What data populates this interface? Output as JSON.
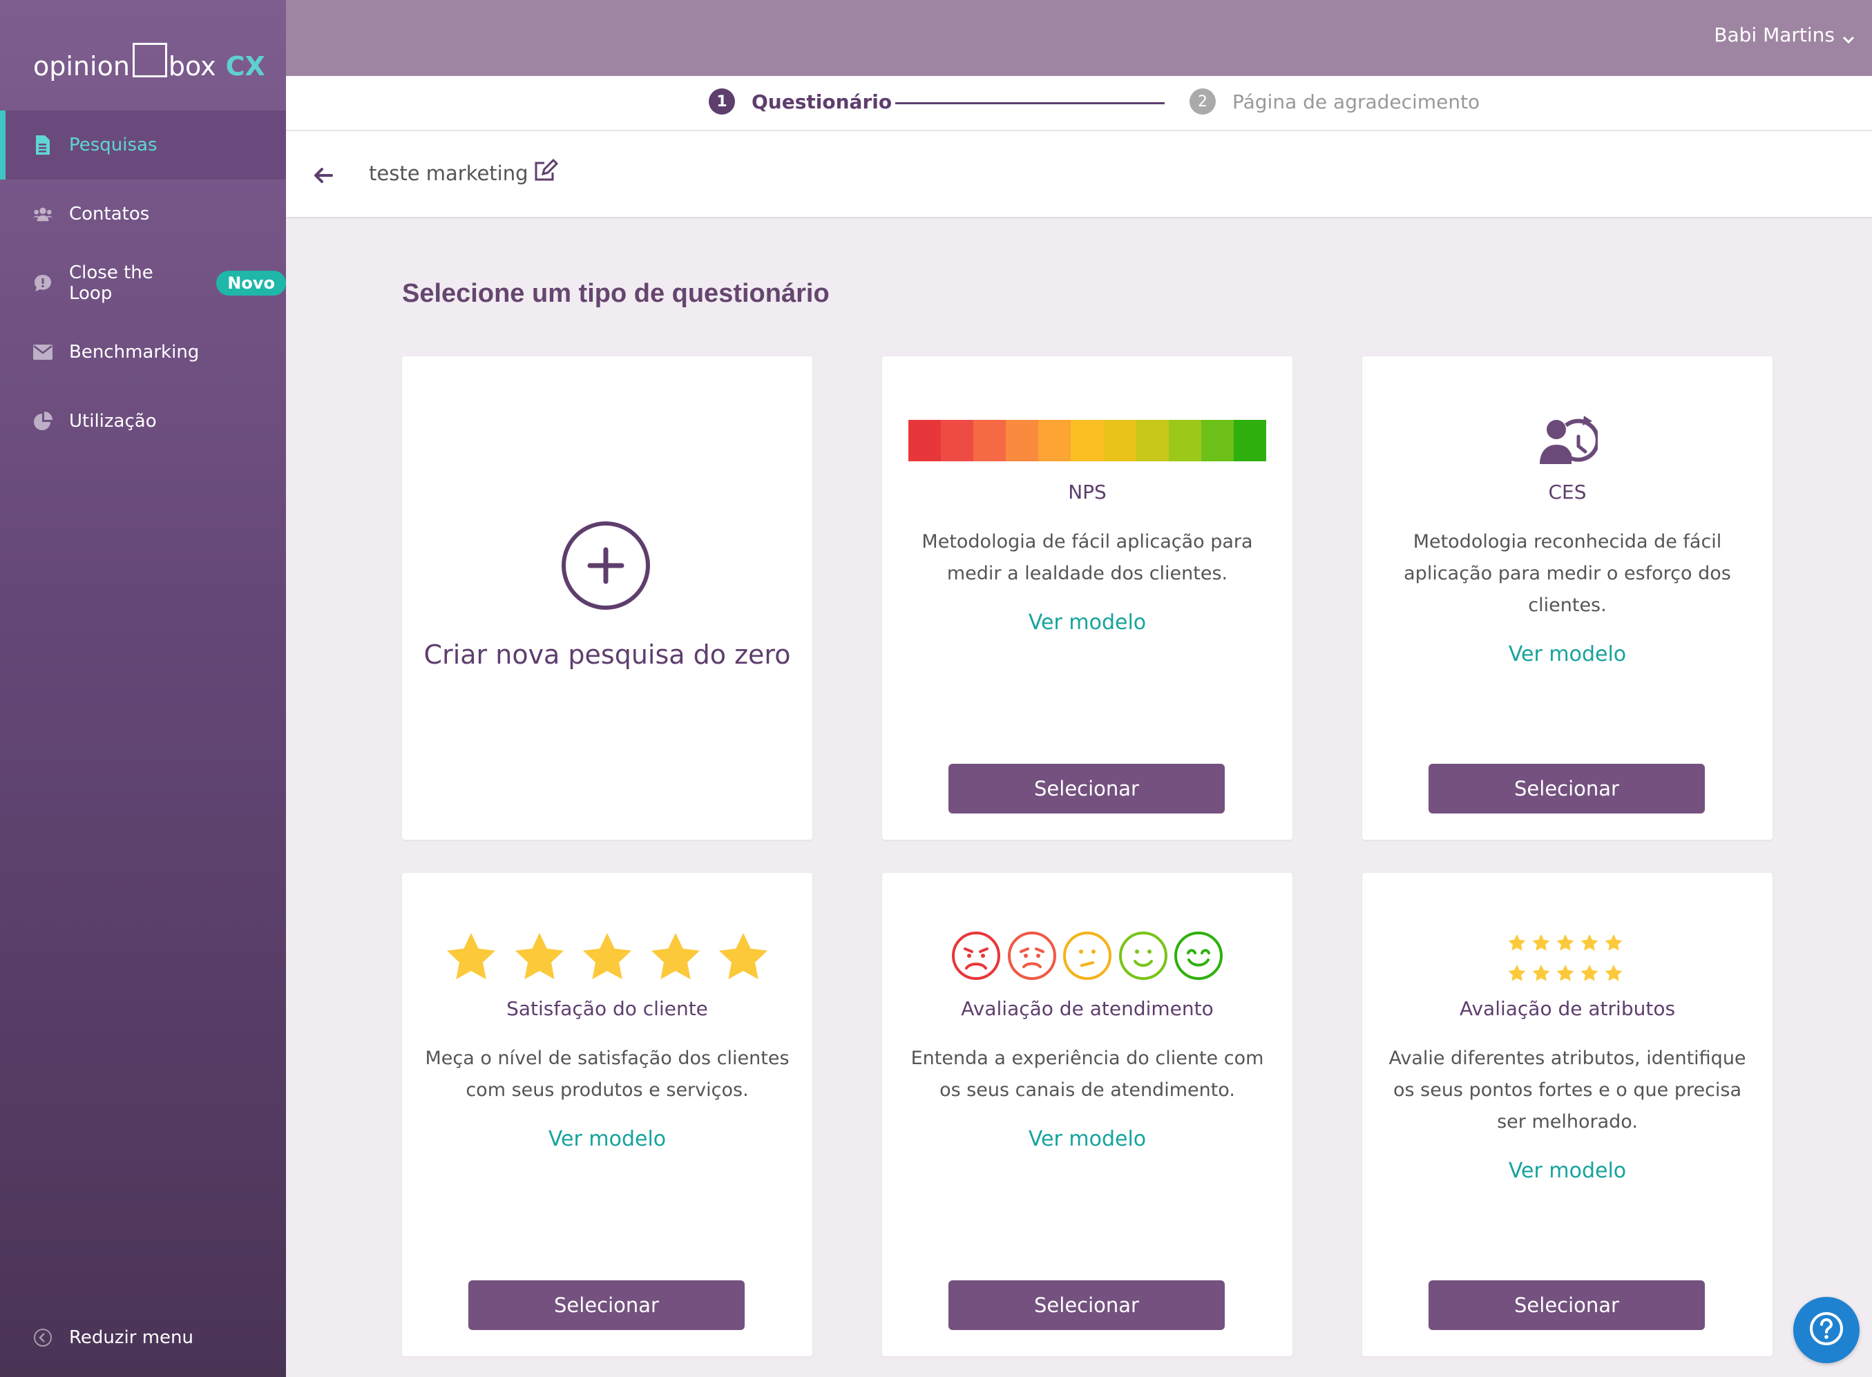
{
  "logo": {
    "brand_left": "opinion",
    "brand_right": "box",
    "suffix": "CX"
  },
  "sidebar": {
    "items": [
      {
        "label": "Pesquisas",
        "icon": "document-icon",
        "active": true
      },
      {
        "label": "Contatos",
        "icon": "users-icon"
      },
      {
        "label": "Close the Loop",
        "icon": "chat-bubble-icon",
        "badge": "Novo"
      },
      {
        "label": "Benchmarking",
        "icon": "envelope-icon"
      },
      {
        "label": "Utilização",
        "icon": "pie-chart-icon"
      }
    ],
    "reduce_label": "Reduzir menu"
  },
  "topbar": {
    "user_name": "Babi Martins"
  },
  "stepper": {
    "steps": [
      {
        "num": "1",
        "label": "Questionário",
        "active": true
      },
      {
        "num": "2",
        "label": "Página de agradecimento",
        "active": false
      }
    ]
  },
  "survey": {
    "name": "teste marketing"
  },
  "main": {
    "title": "Selecione um tipo de questionário",
    "create_label": "Criar nova pesquisa do zero",
    "cards": [
      {
        "title": "NPS",
        "desc_lines": [
          "Metodologia de fácil aplicação para",
          "medir a lealdade dos clientes."
        ],
        "link": "Ver modelo",
        "button": "Selecionar"
      },
      {
        "title": "CES",
        "desc_lines": [
          "Metodologia reconhecida de fácil",
          "aplicação para medir o esforço dos",
          "clientes."
        ],
        "link": "Ver modelo",
        "button": "Selecionar"
      },
      {
        "title": "Satisfação do cliente",
        "desc_lines": [
          "Meça o nível de satisfação dos clientes",
          "com seus produtos e serviços."
        ],
        "link": "Ver modelo",
        "button": "Selecionar"
      },
      {
        "title": "Avaliação de atendimento",
        "desc_lines": [
          "Entenda a experiência do cliente com",
          "os seus canais de atendimento."
        ],
        "link": "Ver modelo",
        "button": "Selecionar"
      },
      {
        "title": "Avaliação de atributos",
        "desc_lines": [
          "Avalie diferentes atributos, identifique",
          "os seus pontos fortes e o que precisa",
          "ser melhorado."
        ],
        "link": "Ver modelo",
        "button": "Selecionar"
      }
    ]
  },
  "colors": {
    "accent": "#5e3e6d",
    "teal": "#16a39c",
    "button": "#74517f",
    "nps_scale": [
      "#e8373a",
      "#ef4b45",
      "#f56a45",
      "#fa8b3e",
      "#fca434",
      "#fbbf24",
      "#e9c21a",
      "#c7c81a",
      "#9cc81a",
      "#6cc018",
      "#2fb00e"
    ],
    "faces": [
      "#e8373a",
      "#ef5a45",
      "#f5b21a",
      "#7ac41a",
      "#2fb00e"
    ],
    "star": "#fcc93a"
  }
}
